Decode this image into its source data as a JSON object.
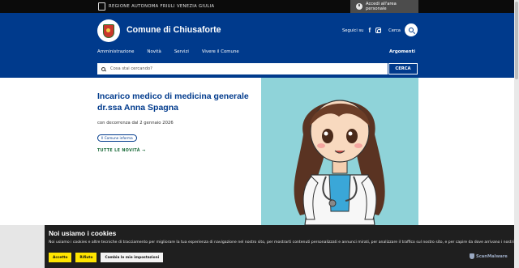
{
  "topbar": {
    "region_name": "REGIONE AUTONOMA FRIULI VENEZIA GIULIA",
    "access_label": "Accedi all'area personale"
  },
  "header": {
    "title": "Comune di Chiusaforte",
    "follow_label": "Seguici su",
    "search_label": "Cerca",
    "nav": [
      "Amministrazione",
      "Novità",
      "Servizi",
      "Vivere il Comune"
    ],
    "topics_label": "Argomenti",
    "search_placeholder": "Cosa stai cercando?",
    "search_button": "CERCA"
  },
  "hero": {
    "title": "Incarico medico di medicina generale dr.ssa Anna Spagna",
    "subtitle": "con decorrenza dal 2 gennaio 2026",
    "tag": "Il Comune informa",
    "more_link": "TUTTE LE NOVITÀ"
  },
  "cookie": {
    "title": "Noi usiamo i cookies",
    "text": "Noi usiamo i cookies e altre tecniche di tracciamento per migliorare la tua esperienza di navigazione nel nostro sito, per mostrarti contenuti personalizzati e annunci mirati, per analizzare il traffico sul nostro sito, e per capire da dove arrivano i nostri visitatori.",
    "accept": "Accetto",
    "reject": "Rifiuto",
    "settings": "Cambia le mie impostazioni",
    "brand": "ScanMalware"
  },
  "colors": {
    "brand_blue": "#003a8c",
    "cookie_yellow": "#ffe500",
    "illustration_bg": "#8fd3d9"
  }
}
